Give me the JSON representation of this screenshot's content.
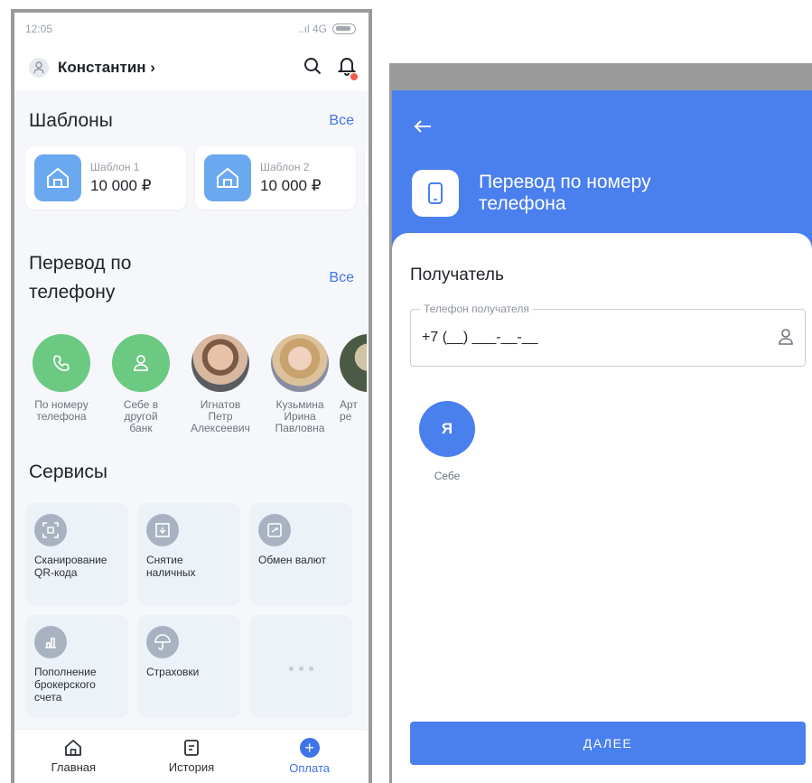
{
  "left": {
    "status": {
      "time": "12:05",
      "signal": "..ıl 4G"
    },
    "user": {
      "name": "Константин ›"
    },
    "templates": {
      "title": "Шаблоны",
      "all_link": "Все",
      "items": [
        {
          "label": "Шаблон 1",
          "amount": "10 000 ₽"
        },
        {
          "label": "Шаблон 2",
          "amount": "10 000 ₽"
        }
      ]
    },
    "phone_transfer": {
      "title": "Перевод по телефону",
      "all_link": "Все",
      "contacts": [
        {
          "label": "По номеру телефона",
          "icon": "phone-icon"
        },
        {
          "label": "Себе в другой банк",
          "icon": "person-icon"
        },
        {
          "label": "Игнатов Петр Алексеевич",
          "icon": "avatar"
        },
        {
          "label": "Кузьмина Ирина Павловна",
          "icon": "avatar"
        },
        {
          "label": "Арт ре",
          "icon": "avatar"
        }
      ]
    },
    "services": {
      "title": "Сервисы",
      "items": [
        {
          "label": "Сканирование QR-кода",
          "icon": "qr-scan-icon"
        },
        {
          "label": "Снятие наличных",
          "icon": "cash-withdraw-icon"
        },
        {
          "label": "Обмен валют",
          "icon": "currency-exchange-icon"
        },
        {
          "label": "Пополнение брокерского счета",
          "icon": "broker-chart-icon"
        },
        {
          "label": "Страховки",
          "icon": "umbrella-icon"
        }
      ]
    },
    "tabbar": [
      {
        "label": "Главная",
        "icon": "home-icon"
      },
      {
        "label": "История",
        "icon": "history-icon"
      },
      {
        "label": "Оплата",
        "icon": "plus-icon"
      }
    ]
  },
  "right": {
    "header_title": "Перевод по номеру телефона",
    "recipient_title": "Получатель",
    "phone_field": {
      "legend": "Телефон получателя",
      "value": "+7 (__) ___-__-__"
    },
    "self": {
      "initial": "Я",
      "label": "Себе"
    },
    "next_button": "ДАЛЕЕ"
  },
  "colors": {
    "accent": "#4a7fee",
    "link": "#3f74e8",
    "green": "#6cc982",
    "template_icon": "#6aa8f0"
  }
}
